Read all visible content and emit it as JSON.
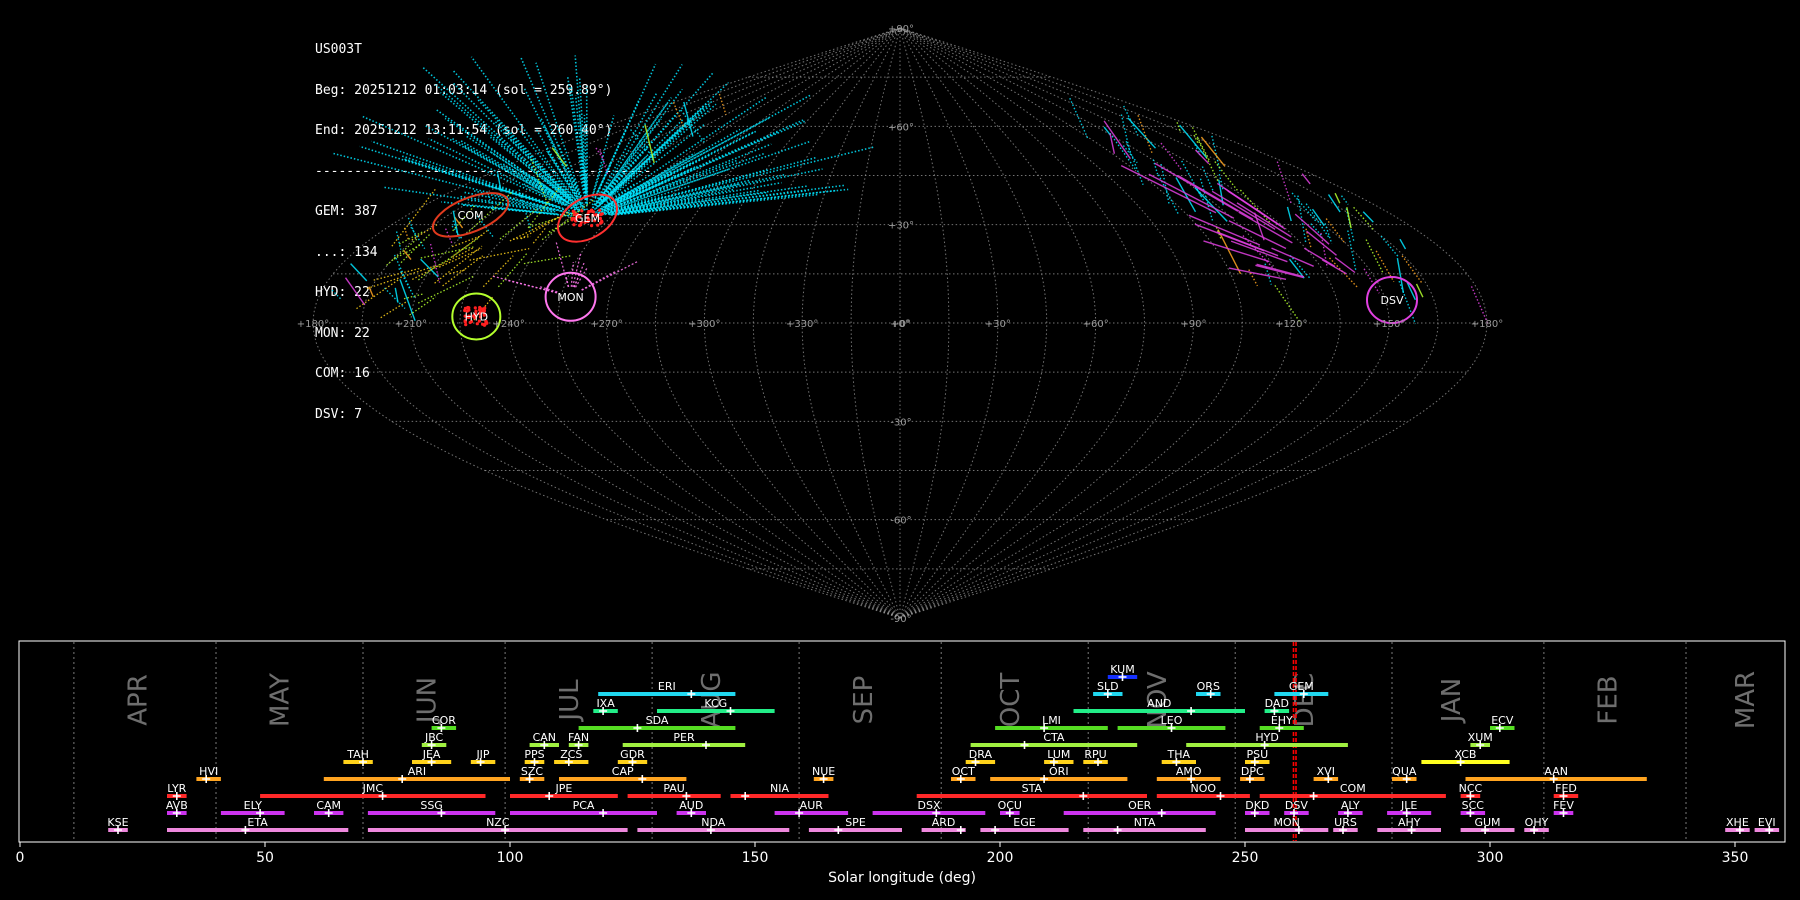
{
  "stats": {
    "station": "US003T",
    "beg": "Beg: 20251212 01:03:14 (sol = 259.89°)",
    "end": "End: 20251212 13:11:54 (sol = 260.40°)",
    "separator": "-------------------------------------------",
    "counts": [
      "GEM: 387",
      "...: 134",
      "HYD: 22",
      "MON: 22",
      "COM: 16",
      "DSV: 7"
    ]
  },
  "colors": {
    "background": "#000000",
    "sporadic": "#00e5ff",
    "grid": "#9a9a9a",
    "month_text": "#6e6e6e",
    "current_line": "#ff0000"
  },
  "chart_data": [
    {
      "type": "scatter",
      "projection": "sinusoidal",
      "lon_labels": [
        "+180°",
        "+150°",
        "+120°",
        "+90°",
        "+60°",
        "+30°",
        "+0°",
        "+330°",
        "+300°",
        "+270°",
        "+240°",
        "+210°",
        "+180°"
      ],
      "lat_labels": [
        "+90°",
        "+60°",
        "+30°",
        "+0°",
        "-30°",
        "-60°",
        "-90°"
      ],
      "radiants": [
        {
          "name": "COM",
          "color": "#e03a1e",
          "lon": 157,
          "lat": 33
        },
        {
          "name": "GEM",
          "color": "#ff3030",
          "lon": 113,
          "lat": 32
        },
        {
          "name": "HYD",
          "color": "#b4ff2d",
          "lon": 130,
          "lat": 2
        },
        {
          "name": "MON",
          "color": "#ff77ee",
          "lon": 102,
          "lat": 8
        },
        {
          "name": "DSV",
          "color": "#e040e0",
          "lon": 208,
          "lat": 7
        }
      ]
    },
    {
      "type": "timeline",
      "xlabel": "Solar longitude (deg)",
      "xlim": [
        0,
        360
      ],
      "xticks": [
        "0",
        "50",
        "100",
        "150",
        "200",
        "250",
        "300",
        "350"
      ],
      "current_solar_longitude": [
        259.89,
        260.4
      ],
      "month_boundaries": [
        11,
        40,
        70,
        99,
        129,
        159,
        188,
        218,
        248,
        280,
        311,
        340
      ],
      "months": [
        {
          "name": "APR",
          "x": 24
        },
        {
          "name": "MAY",
          "x": 53
        },
        {
          "name": "JUN",
          "x": 83
        },
        {
          "name": "JUL",
          "x": 112
        },
        {
          "name": "AUG",
          "x": 141
        },
        {
          "name": "SEP",
          "x": 172
        },
        {
          "name": "OCT",
          "x": 202
        },
        {
          "name": "NOV",
          "x": 232
        },
        {
          "name": "DEC",
          "x": 262
        },
        {
          "name": "JAN",
          "x": 292
        },
        {
          "name": "FEB",
          "x": 324
        },
        {
          "name": "MAR",
          "x": 352
        }
      ],
      "showers": [
        {
          "code": "KUM",
          "start": 222,
          "end": 228,
          "peak": 225,
          "row": 12,
          "color": "#1530ff"
        },
        {
          "code": "ERI",
          "start": 118,
          "end": 146,
          "peak": 137,
          "row": 11,
          "color": "#20d8f0"
        },
        {
          "code": "SLD",
          "start": 219,
          "end": 225,
          "peak": 222,
          "row": 11,
          "color": "#20d8f0"
        },
        {
          "code": "ORS",
          "start": 240,
          "end": 245,
          "peak": 243,
          "row": 11,
          "color": "#20d8f0"
        },
        {
          "code": "GEM",
          "start": 256,
          "end": 267,
          "peak": 262,
          "row": 11,
          "color": "#20d8f0"
        },
        {
          "code": "IXA",
          "start": 117,
          "end": 122,
          "peak": 119,
          "row": 10,
          "color": "#22ee88"
        },
        {
          "code": "KCG",
          "start": 130,
          "end": 154,
          "peak": 145,
          "row": 10,
          "color": "#22ee88"
        },
        {
          "code": "AND",
          "start": 215,
          "end": 250,
          "peak": 239,
          "row": 10,
          "color": "#22ee88"
        },
        {
          "code": "DAD",
          "start": 254,
          "end": 259,
          "peak": 256,
          "row": 10,
          "color": "#22ee88"
        },
        {
          "code": "COR",
          "start": 84,
          "end": 89,
          "peak": 86,
          "row": 9,
          "color": "#55dd22"
        },
        {
          "code": "SDA",
          "start": 114,
          "end": 146,
          "peak": 126,
          "row": 9,
          "color": "#55dd22"
        },
        {
          "code": "LMI",
          "start": 199,
          "end": 222,
          "peak": 209,
          "row": 9,
          "color": "#55dd22"
        },
        {
          "code": "LEO",
          "start": 224,
          "end": 246,
          "peak": 235,
          "row": 9,
          "color": "#55dd22"
        },
        {
          "code": "EHY",
          "start": 253,
          "end": 262,
          "peak": 257,
          "row": 9,
          "color": "#55dd22"
        },
        {
          "code": "ECV",
          "start": 300,
          "end": 305,
          "peak": 302,
          "row": 9,
          "color": "#55dd22"
        },
        {
          "code": "JBC",
          "start": 82,
          "end": 87,
          "peak": 84,
          "row": 8,
          "color": "#a0f040"
        },
        {
          "code": "CAN",
          "start": 104,
          "end": 110,
          "peak": 107,
          "row": 8,
          "color": "#a0f040"
        },
        {
          "code": "FAN",
          "start": 112,
          "end": 116,
          "peak": 114,
          "row": 8,
          "color": "#a0f040"
        },
        {
          "code": "PER",
          "start": 123,
          "end": 148,
          "peak": 140,
          "row": 8,
          "color": "#a0f040"
        },
        {
          "code": "CTA",
          "start": 194,
          "end": 228,
          "peak": 205,
          "row": 8,
          "color": "#a0f040"
        },
        {
          "code": "HYD",
          "start": 238,
          "end": 271,
          "peak": 254,
          "row": 8,
          "color": "#a0f040"
        },
        {
          "code": "XUM",
          "start": 296,
          "end": 300,
          "peak": 298,
          "row": 8,
          "color": "#a0f040"
        },
        {
          "code": "TAH",
          "start": 66,
          "end": 72,
          "peak": 70,
          "row": 7,
          "color": "#ffd21a"
        },
        {
          "code": "JEA",
          "start": 80,
          "end": 88,
          "peak": 84,
          "row": 7,
          "color": "#ffd21a"
        },
        {
          "code": "JIP",
          "start": 92,
          "end": 97,
          "peak": 94,
          "row": 7,
          "color": "#ffd21a"
        },
        {
          "code": "PPS",
          "start": 103,
          "end": 107,
          "peak": 105,
          "row": 7,
          "color": "#ffd21a"
        },
        {
          "code": "ZCS",
          "start": 109,
          "end": 116,
          "peak": 112,
          "row": 7,
          "color": "#ffd21a"
        },
        {
          "code": "GDR",
          "start": 122,
          "end": 128,
          "peak": 125,
          "row": 7,
          "color": "#ffd21a"
        },
        {
          "code": "DRA",
          "start": 193,
          "end": 199,
          "peak": 195,
          "row": 7,
          "color": "#ffd21a"
        },
        {
          "code": "LUM",
          "start": 209,
          "end": 215,
          "peak": 211,
          "row": 7,
          "color": "#ffd21a"
        },
        {
          "code": "RPU",
          "start": 217,
          "end": 222,
          "peak": 220,
          "row": 7,
          "color": "#ffd21a"
        },
        {
          "code": "THA",
          "start": 233,
          "end": 240,
          "peak": 236,
          "row": 7,
          "color": "#ffd21a"
        },
        {
          "code": "PSU",
          "start": 250,
          "end": 255,
          "peak": 252,
          "row": 7,
          "color": "#ffd21a"
        },
        {
          "code": "XCB",
          "start": 286,
          "end": 304,
          "peak": 294,
          "row": 7,
          "color": "#ffff20"
        },
        {
          "code": "HVI",
          "start": 36,
          "end": 41,
          "peak": 38,
          "row": 6,
          "color": "#ffa420"
        },
        {
          "code": "ARI",
          "start": 62,
          "end": 100,
          "peak": 78,
          "row": 6,
          "color": "#ffa420"
        },
        {
          "code": "SZC",
          "start": 102,
          "end": 107,
          "peak": 104,
          "row": 6,
          "color": "#ffa420"
        },
        {
          "code": "CAP",
          "start": 110,
          "end": 136,
          "peak": 127,
          "row": 6,
          "color": "#ffa420"
        },
        {
          "code": "NUE",
          "start": 162,
          "end": 166,
          "peak": 164,
          "row": 6,
          "color": "#ffa420"
        },
        {
          "code": "OCT",
          "start": 190,
          "end": 195,
          "peak": 192,
          "row": 6,
          "color": "#ffa420"
        },
        {
          "code": "ORI",
          "start": 198,
          "end": 226,
          "peak": 209,
          "row": 6,
          "color": "#ffa420"
        },
        {
          "code": "AMO",
          "start": 232,
          "end": 245,
          "peak": 239,
          "row": 6,
          "color": "#ffa420"
        },
        {
          "code": "DPC",
          "start": 249,
          "end": 254,
          "peak": 251,
          "row": 6,
          "color": "#ffa420"
        },
        {
          "code": "XVI",
          "start": 264,
          "end": 269,
          "peak": 267,
          "row": 6,
          "color": "#ffa420"
        },
        {
          "code": "QUA",
          "start": 280,
          "end": 285,
          "peak": 283,
          "row": 6,
          "color": "#ffa420"
        },
        {
          "code": "AAN",
          "start": 295,
          "end": 332,
          "peak": 313,
          "row": 6,
          "color": "#ffa420"
        },
        {
          "code": "LYR",
          "start": 30,
          "end": 34,
          "peak": 32,
          "row": 5,
          "color": "#ff2828"
        },
        {
          "code": "JMC",
          "start": 49,
          "end": 95,
          "peak": 74,
          "row": 5,
          "color": "#ff2828"
        },
        {
          "code": "JPE",
          "start": 100,
          "end": 122,
          "peak": 108,
          "row": 5,
          "color": "#ff2828"
        },
        {
          "code": "PAU",
          "start": 124,
          "end": 143,
          "peak": 136,
          "row": 5,
          "color": "#ff2828"
        },
        {
          "code": "NIA",
          "start": 145,
          "end": 165,
          "peak": 148,
          "row": 5,
          "color": "#ff2828"
        },
        {
          "code": "STA",
          "start": 183,
          "end": 230,
          "peak": 217,
          "row": 5,
          "color": "#ff2828"
        },
        {
          "code": "NOO",
          "start": 232,
          "end": 251,
          "peak": 245,
          "row": 5,
          "color": "#ff2828"
        },
        {
          "code": "COM",
          "start": 253,
          "end": 291,
          "peak": 264,
          "row": 5,
          "color": "#ff2828"
        },
        {
          "code": "NCC",
          "start": 294,
          "end": 298,
          "peak": 296,
          "row": 5,
          "color": "#ff2828"
        },
        {
          "code": "FED",
          "start": 313,
          "end": 318,
          "peak": 315,
          "row": 5,
          "color": "#ff2828"
        },
        {
          "code": "AVB",
          "start": 30,
          "end": 34,
          "peak": 32,
          "row": 4,
          "color": "#cc33ee"
        },
        {
          "code": "ELY",
          "start": 41,
          "end": 54,
          "peak": 49,
          "row": 4,
          "color": "#cc33ee"
        },
        {
          "code": "CAM",
          "start": 60,
          "end": 66,
          "peak": 63,
          "row": 4,
          "color": "#cc33ee"
        },
        {
          "code": "SSG",
          "start": 71,
          "end": 97,
          "peak": 86,
          "row": 4,
          "color": "#cc33ee"
        },
        {
          "code": "PCA",
          "start": 100,
          "end": 130,
          "peak": 119,
          "row": 4,
          "color": "#cc33ee"
        },
        {
          "code": "AUD",
          "start": 134,
          "end": 140,
          "peak": 137,
          "row": 4,
          "color": "#cc33ee"
        },
        {
          "code": "AUR",
          "start": 154,
          "end": 169,
          "peak": 159,
          "row": 4,
          "color": "#cc33ee"
        },
        {
          "code": "DSX",
          "start": 174,
          "end": 197,
          "peak": 187,
          "row": 4,
          "color": "#cc33ee"
        },
        {
          "code": "OCU",
          "start": 200,
          "end": 204,
          "peak": 202,
          "row": 4,
          "color": "#cc33ee"
        },
        {
          "code": "OER",
          "start": 213,
          "end": 244,
          "peak": 233,
          "row": 4,
          "color": "#cc33ee"
        },
        {
          "code": "DKD",
          "start": 250,
          "end": 255,
          "peak": 252,
          "row": 4,
          "color": "#cc33ee"
        },
        {
          "code": "DSV",
          "start": 258,
          "end": 263,
          "peak": 260,
          "row": 4,
          "color": "#cc33ee"
        },
        {
          "code": "ALY",
          "start": 269,
          "end": 274,
          "peak": 271,
          "row": 4,
          "color": "#cc33ee"
        },
        {
          "code": "JLE",
          "start": 279,
          "end": 288,
          "peak": 283,
          "row": 4,
          "color": "#cc33ee"
        },
        {
          "code": "SCC",
          "start": 294,
          "end": 299,
          "peak": 296,
          "row": 4,
          "color": "#cc33ee"
        },
        {
          "code": "FEV",
          "start": 313,
          "end": 317,
          "peak": 315,
          "row": 4,
          "color": "#cc33ee"
        },
        {
          "code": "KSE",
          "start": 18,
          "end": 22,
          "peak": 20,
          "row": 3,
          "color": "#ee88dd"
        },
        {
          "code": "ETA",
          "start": 30,
          "end": 67,
          "peak": 46,
          "row": 3,
          "color": "#ee88dd"
        },
        {
          "code": "NZC",
          "start": 71,
          "end": 124,
          "peak": 99,
          "row": 3,
          "color": "#ee88dd"
        },
        {
          "code": "NDA",
          "start": 126,
          "end": 157,
          "peak": 141,
          "row": 3,
          "color": "#ee88dd"
        },
        {
          "code": "SPE",
          "start": 161,
          "end": 180,
          "peak": 167,
          "row": 3,
          "color": "#ee88dd"
        },
        {
          "code": "ARD",
          "start": 184,
          "end": 193,
          "peak": 192,
          "row": 3,
          "color": "#ee88dd"
        },
        {
          "code": "EGE",
          "start": 196,
          "end": 214,
          "peak": 199,
          "row": 3,
          "color": "#ee88dd"
        },
        {
          "code": "NTA",
          "start": 217,
          "end": 242,
          "peak": 224,
          "row": 3,
          "color": "#ee88dd"
        },
        {
          "code": "MON",
          "start": 250,
          "end": 267,
          "peak": 261,
          "row": 3,
          "color": "#ee88dd"
        },
        {
          "code": "URS",
          "start": 268,
          "end": 273,
          "peak": 270,
          "row": 3,
          "color": "#ee88dd"
        },
        {
          "code": "AHY",
          "start": 277,
          "end": 290,
          "peak": 284,
          "row": 3,
          "color": "#ee88dd"
        },
        {
          "code": "GUM",
          "start": 294,
          "end": 305,
          "peak": 299,
          "row": 3,
          "color": "#ee88dd"
        },
        {
          "code": "OHY",
          "start": 307,
          "end": 312,
          "peak": 309,
          "row": 3,
          "color": "#ee88dd"
        },
        {
          "code": "XHE",
          "start": 348,
          "end": 353,
          "peak": 351,
          "row": 3,
          "color": "#ee88dd"
        },
        {
          "code": "EVI",
          "start": 354,
          "end": 359,
          "peak": 357,
          "row": 3,
          "color": "#ee88dd"
        }
      ]
    }
  ]
}
